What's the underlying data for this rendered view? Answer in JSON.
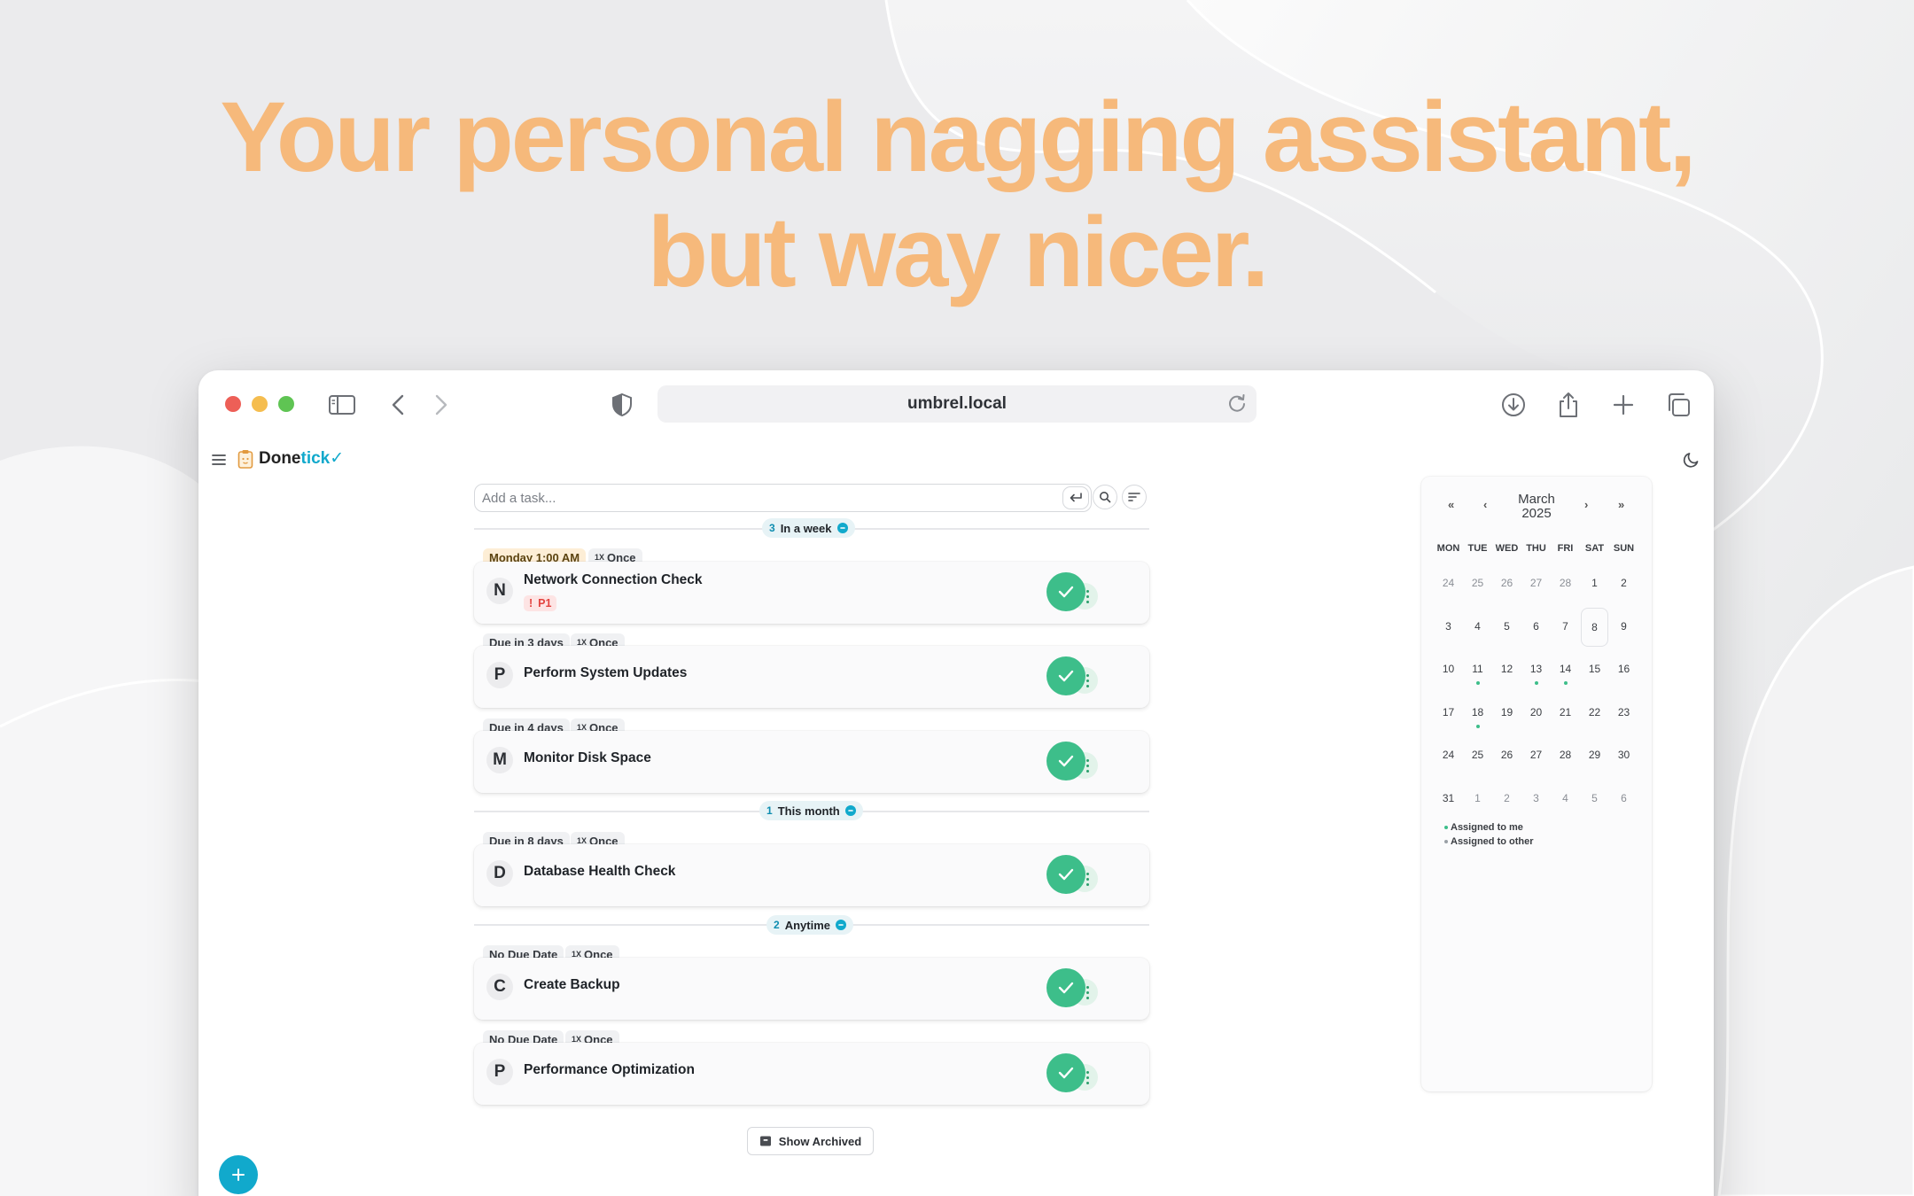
{
  "hero": {
    "line1": "Your personal nagging assistant,",
    "line2": "but way nicer."
  },
  "browser": {
    "url": "umbrel.local",
    "icons": [
      "sidebar-icon",
      "back-icon",
      "forward-icon",
      "shield-icon",
      "reload-icon",
      "download-icon",
      "share-icon",
      "new-tab-icon",
      "tabs-icon"
    ]
  },
  "app": {
    "logo_part1": "Done",
    "logo_part2": "tick",
    "add_placeholder": "Add a task...",
    "show_archived": "Show Archived",
    "colors": {
      "accent": "#11a9cc",
      "complete": "#3dbe8a",
      "hero": "#f6b97b",
      "priority": "#e3433f"
    }
  },
  "groups": [
    {
      "count": "3",
      "label": "In a week"
    },
    {
      "count": "1",
      "label": "This month"
    },
    {
      "count": "2",
      "label": "Anytime"
    }
  ],
  "tasks": [
    {
      "due": "Monday 1:00 AM",
      "freq_x": "1X",
      "freq": "Once",
      "initial": "N",
      "title": "Network Connection Check",
      "priority": "P1"
    },
    {
      "due": "Due in 3 days",
      "freq_x": "1X",
      "freq": "Once",
      "initial": "P",
      "title": "Perform System Updates"
    },
    {
      "due": "Due in 4 days",
      "freq_x": "1X",
      "freq": "Once",
      "initial": "M",
      "title": "Monitor Disk Space"
    },
    {
      "due": "Due in 8 days",
      "freq_x": "1X",
      "freq": "Once",
      "initial": "D",
      "title": "Database Health Check"
    },
    {
      "due": "No Due Date",
      "freq_x": "1X",
      "freq": "Once",
      "initial": "C",
      "title": "Create Backup"
    },
    {
      "due": "No Due Date",
      "freq_x": "1X",
      "freq": "Once",
      "initial": "P",
      "title": "Performance Optimization"
    }
  ],
  "calendar": {
    "month": "March",
    "year": "2025",
    "nav": [
      "«",
      "‹",
      "›",
      "»"
    ],
    "weekdays": [
      "MON",
      "TUE",
      "WED",
      "THU",
      "FRI",
      "SAT",
      "SUN"
    ],
    "days": [
      {
        "d": "24",
        "m": true
      },
      {
        "d": "25",
        "m": true
      },
      {
        "d": "26",
        "m": true
      },
      {
        "d": "27",
        "m": true
      },
      {
        "d": "28",
        "m": true
      },
      {
        "d": "1"
      },
      {
        "d": "2"
      },
      {
        "d": "3"
      },
      {
        "d": "4"
      },
      {
        "d": "5"
      },
      {
        "d": "6"
      },
      {
        "d": "7"
      },
      {
        "d": "8",
        "today": true
      },
      {
        "d": "9"
      },
      {
        "d": "10"
      },
      {
        "d": "11",
        "dot": true
      },
      {
        "d": "12"
      },
      {
        "d": "13",
        "dot": true
      },
      {
        "d": "14",
        "dot": true
      },
      {
        "d": "15"
      },
      {
        "d": "16"
      },
      {
        "d": "17"
      },
      {
        "d": "18",
        "dot": true
      },
      {
        "d": "19"
      },
      {
        "d": "20"
      },
      {
        "d": "21"
      },
      {
        "d": "22"
      },
      {
        "d": "23"
      },
      {
        "d": "24"
      },
      {
        "d": "25"
      },
      {
        "d": "26"
      },
      {
        "d": "27"
      },
      {
        "d": "28"
      },
      {
        "d": "29"
      },
      {
        "d": "30"
      },
      {
        "d": "31"
      },
      {
        "d": "1",
        "m": true
      },
      {
        "d": "2",
        "m": true
      },
      {
        "d": "3",
        "m": true
      },
      {
        "d": "4",
        "m": true
      },
      {
        "d": "5",
        "m": true
      },
      {
        "d": "6",
        "m": true
      }
    ],
    "legend_me": "Assigned to me",
    "legend_other": "Assigned to other"
  }
}
